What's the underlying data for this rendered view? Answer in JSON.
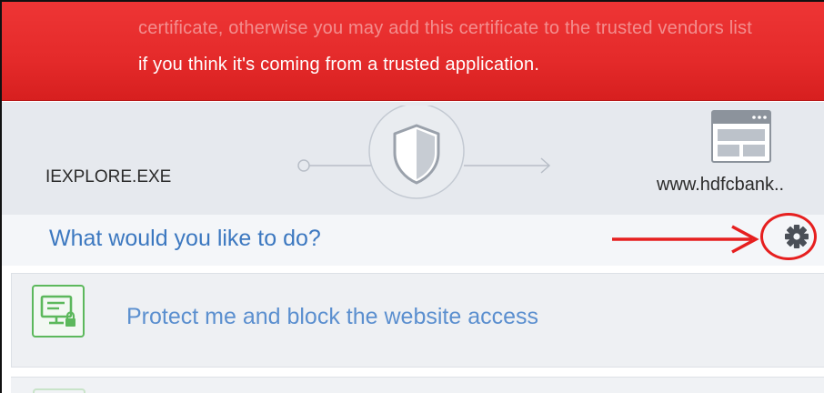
{
  "alert": {
    "line1": "certificate, otherwise you may add this certificate to the trusted vendors list",
    "line2": "if you think it's coming from a trusted application."
  },
  "connection": {
    "process_name": "IEXPLORE.EXE",
    "website": "www.hdfcbank..",
    "icons": [
      "shield-icon",
      "browser-window-icon"
    ]
  },
  "question": {
    "text": "What would you like to do?"
  },
  "options": [
    {
      "label": "Protect me and block the website access",
      "icon": "monitor-lock-icon"
    }
  ],
  "settings": {
    "icon": "gear-icon"
  },
  "colors": {
    "alert_red": "#e42a2a",
    "question_blue": "#3c78c0",
    "option_blue": "#5b8fcf",
    "icon_green": "#5cb85c",
    "annotation_red": "#e61f1f"
  }
}
